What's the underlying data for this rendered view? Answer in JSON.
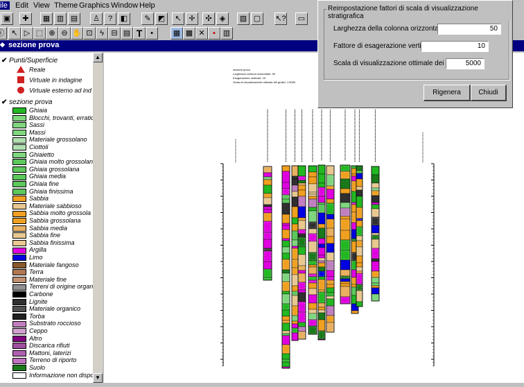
{
  "menu": {
    "file": "ile",
    "edit": "Edit",
    "view": "View",
    "theme": "Theme",
    "graphics": "Graphics",
    "window": "Window",
    "help": "Help"
  },
  "window_title": "sezione prova",
  "legend": {
    "group1_title": "Punti/Superficie",
    "group1_items": [
      {
        "label": "Reale",
        "icon": "triangle-icon"
      },
      {
        "label": "Virtuale in indagine",
        "icon": "square-icon"
      },
      {
        "label": "Virtuale esterno ad ind",
        "icon": "circle-icon"
      }
    ],
    "group2_title": "sezione prova",
    "group2_items": [
      {
        "label": "Ghiaia",
        "color": "#22b822"
      },
      {
        "label": "Blocchi, trovanti, erratic",
        "color": "#7fd67f"
      },
      {
        "label": "Sassi",
        "color": "#7fd67f"
      },
      {
        "label": "Massi",
        "color": "#7fd67f"
      },
      {
        "label": "Materiale grossolano",
        "color": "#b0e0b0"
      },
      {
        "label": "Ciottoli",
        "color": "#b0e0b0"
      },
      {
        "label": "Ghiaietto",
        "color": "#7fd67f"
      },
      {
        "label": "Ghiaia molto grossolana",
        "color": "#5cc85c"
      },
      {
        "label": "Ghiaia grossolana",
        "color": "#5cc85c"
      },
      {
        "label": "Ghiaia media",
        "color": "#5cc85c"
      },
      {
        "label": "Ghiaia fine",
        "color": "#5cc85c"
      },
      {
        "label": "Ghiaia finissima",
        "color": "#5cc85c"
      },
      {
        "label": "Sabbia",
        "color": "#f0a020"
      },
      {
        "label": "Materiale sabbioso",
        "color": "#e8c890"
      },
      {
        "label": "Sabbia molto grossola",
        "color": "#f0a020"
      },
      {
        "label": "Sabbia grossolana",
        "color": "#f0a020"
      },
      {
        "label": "Sabbia media",
        "color": "#e8b060"
      },
      {
        "label": "Sabbia fine",
        "color": "#e8c890"
      },
      {
        "label": "Sabbia finissima",
        "color": "#e8c890"
      },
      {
        "label": "Argilla",
        "color": "#e000e0"
      },
      {
        "label": "Limo",
        "color": "#0000e0"
      },
      {
        "label": "Materiale fangoso",
        "color": "#8b5a2b"
      },
      {
        "label": "Terra",
        "color": "#b07850"
      },
      {
        "label": "Materiale fine",
        "color": "#c09070"
      },
      {
        "label": "Terreni di origine organ",
        "color": "#909090"
      },
      {
        "label": "Carbone",
        "color": "#000000"
      },
      {
        "label": "Lignite",
        "color": "#303030"
      },
      {
        "label": "Materiale organico",
        "color": "#505050"
      },
      {
        "label": "Torba",
        "color": "#202020"
      },
      {
        "label": "Substrato roccioso",
        "color": "#c080c0"
      },
      {
        "label": "Ceppo",
        "color": "#d0a0d0"
      },
      {
        "label": "Altro",
        "color": "#800080"
      },
      {
        "label": "Discarica rifiuti",
        "color": "#a050a0"
      },
      {
        "label": "Mattoni, laterizi",
        "color": "#b060b0"
      },
      {
        "label": "Terreno di riporto",
        "color": "#c070c0"
      },
      {
        "label": "Suolo",
        "color": "#1a7a1a"
      },
      {
        "label": "Informazione non dispo",
        "color": "#ffffff"
      }
    ]
  },
  "dialog": {
    "group_title": "Reimpostazione fattori di scala di visualizzazione stratigrafica",
    "width_label": "Larghezza della colonna orizzontale [m]",
    "width_value": "50",
    "exag_label": "Fattore di esagerazione verticale",
    "exag_value": "10",
    "scale_label": "Scala di visualizzazione ottimale dei grafici",
    "scale_value": "5000",
    "regen_button": "Rigenera",
    "close_button": "Chiudi"
  },
  "canvas": {
    "info_line1": "sezione prova",
    "info_line2": "Larghezza colonna orizzontale: 50",
    "info_line3": "Esagerazione verticale: 10",
    "info_line4": "Scala di visualizzazione ottimale dei grafici: 1:5000"
  },
  "colors": {
    "titlebar": "#000080",
    "gravel": "#22b822",
    "sand": "#f0a020",
    "clay": "#e000e0"
  }
}
